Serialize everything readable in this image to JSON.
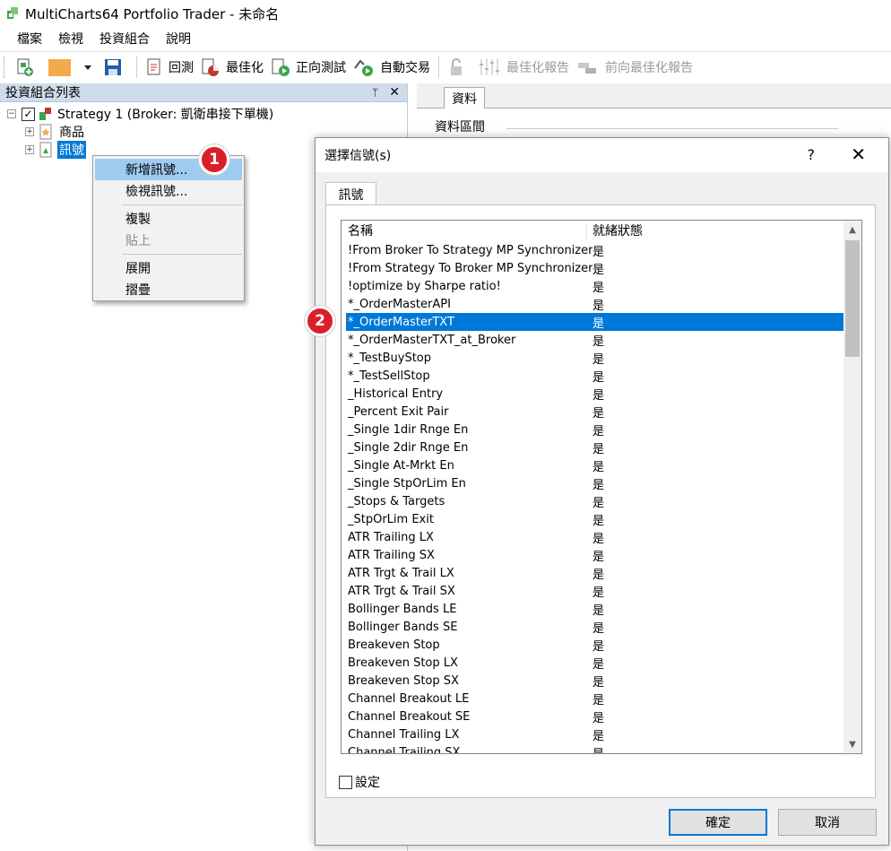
{
  "window": {
    "title": "MultiCharts64 Portfolio Trader - 未命名"
  },
  "menu": [
    "檔案",
    "檢視",
    "投資組合",
    "說明"
  ],
  "toolbar": {
    "backtest": "回測",
    "optimize": "最佳化",
    "walkforward": "正向測試",
    "autotrade": "自動交易",
    "opt_report": "最佳化報告",
    "wf_report": "前向最佳化報告"
  },
  "left_panel": {
    "title": "投資組合列表",
    "pin": "ᛘ",
    "close": "✕",
    "tree": {
      "strategy": "Strategy 1 (Broker: 凱衛串接下單機)",
      "instruments": "商品",
      "signals": "訊號"
    }
  },
  "context_menu": {
    "items": [
      "新增訊號...",
      "檢視訊號...",
      "複製",
      "貼上",
      "展開",
      "摺疊"
    ]
  },
  "badges": {
    "one": "1",
    "two": "2"
  },
  "right_panel": {
    "tab": "資料",
    "section": "資料區間"
  },
  "dialog": {
    "title": "選擇信號(s)",
    "help": "?",
    "close": "✕",
    "tab": "訊號",
    "columns": {
      "name": "名稱",
      "status": "就緒狀態"
    },
    "rows": [
      {
        "name": "!From Broker To Strategy MP Synchronizer!",
        "status": "是"
      },
      {
        "name": "!From Strategy To Broker MP Synchronizer!",
        "status": "是"
      },
      {
        "name": "!optimize by Sharpe ratio!",
        "status": "是"
      },
      {
        "name": "*_OrderMasterAPI",
        "status": "是"
      },
      {
        "name": "*_OrderMasterTXT",
        "status": "是"
      },
      {
        "name": "*_OrderMasterTXT_at_Broker",
        "status": "是"
      },
      {
        "name": "*_TestBuyStop",
        "status": "是"
      },
      {
        "name": "*_TestSellStop",
        "status": "是"
      },
      {
        "name": "_Historical Entry",
        "status": "是"
      },
      {
        "name": "_Percent Exit Pair",
        "status": "是"
      },
      {
        "name": "_Single 1dir Rnge En",
        "status": "是"
      },
      {
        "name": "_Single 2dir Rnge En",
        "status": "是"
      },
      {
        "name": "_Single At-Mrkt En",
        "status": "是"
      },
      {
        "name": "_Single StpOrLim En",
        "status": "是"
      },
      {
        "name": "_Stops & Targets",
        "status": "是"
      },
      {
        "name": "_StpOrLim Exit",
        "status": "是"
      },
      {
        "name": "ATR Trailing LX",
        "status": "是"
      },
      {
        "name": "ATR Trailing SX",
        "status": "是"
      },
      {
        "name": "ATR Trgt & Trail LX",
        "status": "是"
      },
      {
        "name": "ATR Trgt & Trail SX",
        "status": "是"
      },
      {
        "name": "Bollinger Bands LE",
        "status": "是"
      },
      {
        "name": "Bollinger Bands SE",
        "status": "是"
      },
      {
        "name": "Breakeven Stop",
        "status": "是"
      },
      {
        "name": "Breakeven Stop LX",
        "status": "是"
      },
      {
        "name": "Breakeven Stop SX",
        "status": "是"
      },
      {
        "name": "Channel Breakout LE",
        "status": "是"
      },
      {
        "name": "Channel Breakout SE",
        "status": "是"
      },
      {
        "name": "Channel Trailing LX",
        "status": "是"
      },
      {
        "name": "Channel Trailing SX",
        "status": "是"
      }
    ],
    "settings_label": "設定",
    "ok": "確定",
    "cancel": "取消"
  }
}
